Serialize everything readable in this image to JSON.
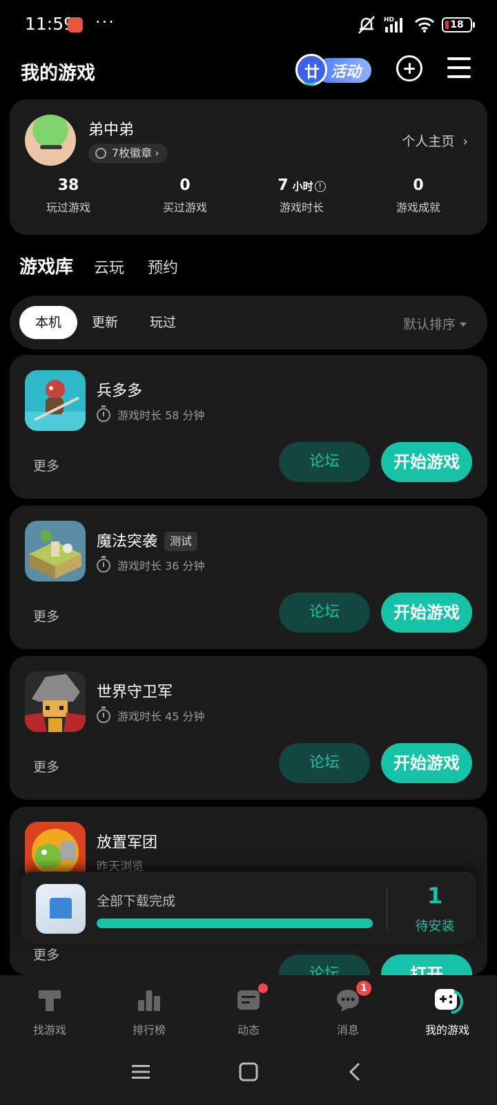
{
  "status_bar": {
    "time": "11:59",
    "more": "···",
    "network": "HD",
    "battery": "18"
  },
  "header": {
    "title": "我的游戏",
    "activity_label": "活动",
    "activity_glyph": "廿"
  },
  "profile": {
    "username": "弟中弟",
    "badges": "7枚徽章",
    "homepage": "个人主页",
    "stats": [
      {
        "value": "38",
        "unit": "",
        "label": "玩过游戏"
      },
      {
        "value": "0",
        "unit": "",
        "label": "买过游戏"
      },
      {
        "value": "7",
        "unit": "小时",
        "label": "游戏时长"
      },
      {
        "value": "0",
        "unit": "",
        "label": "游戏成就"
      }
    ]
  },
  "main_tabs": [
    "游戏库",
    "云玩",
    "预约"
  ],
  "filter": {
    "chips": [
      "本机",
      "更新",
      "玩过"
    ],
    "sort": "默认排序"
  },
  "games": [
    {
      "name": "兵多多",
      "tag": "",
      "playtime": "游戏时长 58 分钟",
      "more": "更多",
      "forum": "论坛",
      "action": "开始游戏"
    },
    {
      "name": "魔法突袭",
      "tag": "测试",
      "playtime": "游戏时长 36 分钟",
      "more": "更多",
      "forum": "论坛",
      "action": "开始游戏"
    },
    {
      "name": "世界守卫军",
      "tag": "",
      "playtime": "游戏时长 45 分钟",
      "more": "更多",
      "forum": "论坛",
      "action": "开始游戏"
    },
    {
      "name": "放置军团",
      "tag": "",
      "playtime": "昨天浏览",
      "more": "更多",
      "forum": "论坛",
      "action": "打开"
    }
  ],
  "download": {
    "status": "全部下载完成",
    "progress": 1.0,
    "count": "1",
    "count_label": "待安装"
  },
  "bottom_nav": [
    {
      "label": "找游戏",
      "icon": "find-game-icon"
    },
    {
      "label": "排行榜",
      "icon": "ranking-icon"
    },
    {
      "label": "动态",
      "icon": "feed-icon"
    },
    {
      "label": "消息",
      "icon": "message-icon",
      "badge": "1"
    },
    {
      "label": "我的游戏",
      "icon": "my-games-icon"
    }
  ],
  "colors": {
    "accent": "#16c2a8",
    "forum_bg": "#12463f",
    "card_bg": "#1b1b1b",
    "badge_red": "#f04848"
  }
}
